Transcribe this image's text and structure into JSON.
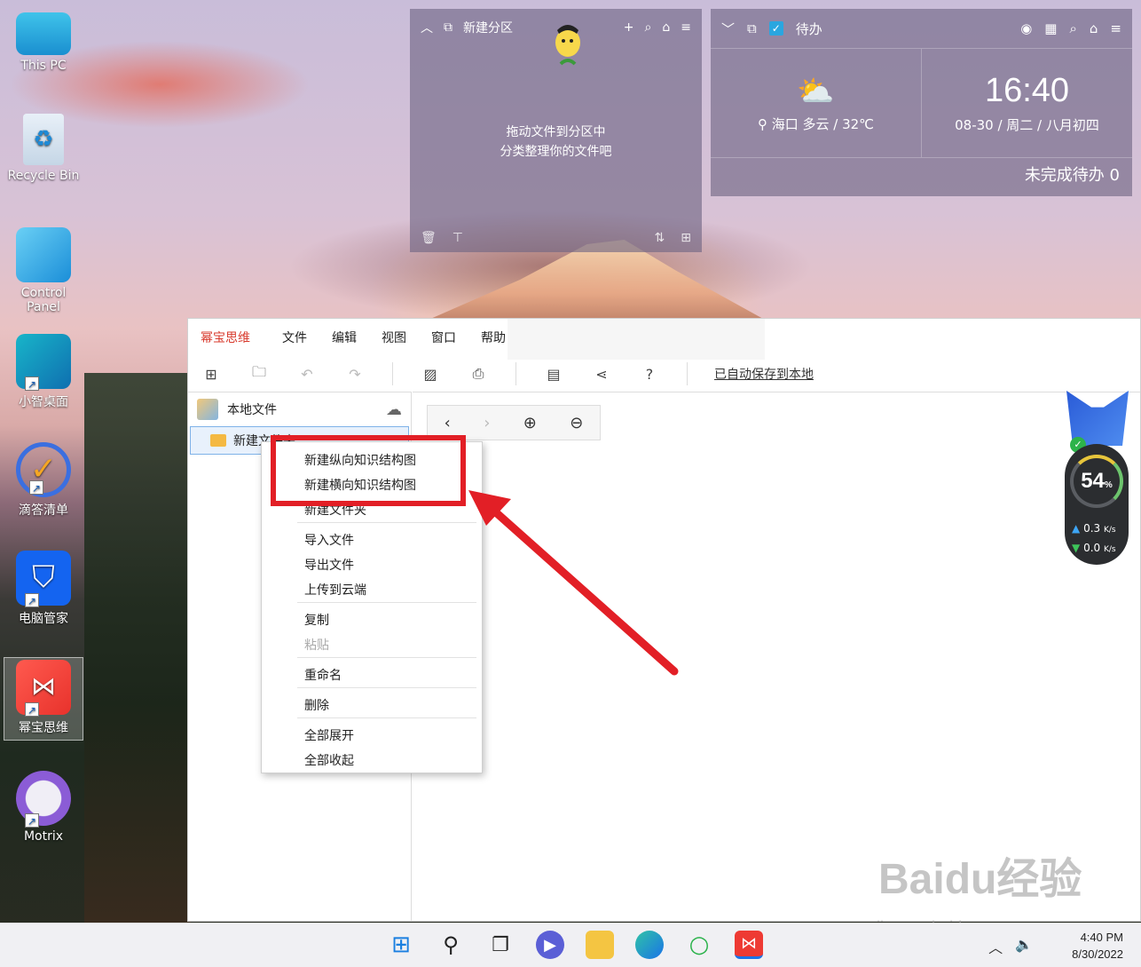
{
  "desktop": {
    "icons": [
      {
        "label": "This PC",
        "icon": "monitor-icon"
      },
      {
        "label": "Recycle Bin",
        "icon": "recycle-bin-icon"
      },
      {
        "label": "Control Panel",
        "icon": "control-panel-icon"
      },
      {
        "label": "小智桌面",
        "icon": "desktop-app-icon"
      },
      {
        "label": "滴答清单",
        "icon": "checklist-icon"
      },
      {
        "label": "电脑管家",
        "icon": "shield-icon"
      },
      {
        "label": "幂宝思维",
        "icon": "mindmap-icon"
      },
      {
        "label": "Motrix",
        "icon": "download-icon"
      }
    ]
  },
  "partition_widget": {
    "title": "新建分区",
    "message_line1": "拖动文件到分区中",
    "message_line2": "分类整理你的文件吧"
  },
  "todo_widget": {
    "title": "待办",
    "time": "16:40",
    "date": "08-30 / 周二 / 八月初四",
    "weather": "海口 多云 / 32℃",
    "pending": "未完成待办 0"
  },
  "app": {
    "brand": "幂宝思维",
    "menu": [
      "文件",
      "编辑",
      "视图",
      "窗口",
      "帮助"
    ],
    "autosave": "已自动保存到本地",
    "sidebar": {
      "header": "本地文件",
      "folder": "新建文件夹"
    }
  },
  "context_menu": {
    "items": [
      {
        "label": "新建纵向知识结构图",
        "enabled": true
      },
      {
        "label": "新建横向知识结构图",
        "enabled": true
      },
      {
        "label": "新建文件夹",
        "enabled": true
      },
      {
        "label": "导入文件",
        "enabled": true
      },
      {
        "label": "导出文件",
        "enabled": true
      },
      {
        "label": "上传到云端",
        "enabled": true
      },
      {
        "label": "复制",
        "enabled": true
      },
      {
        "label": "粘贴",
        "enabled": false
      },
      {
        "label": "重命名",
        "enabled": true
      },
      {
        "label": "删除",
        "enabled": true
      },
      {
        "label": "全部展开",
        "enabled": true
      },
      {
        "label": "全部收起",
        "enabled": true
      }
    ],
    "highlight_color": "#e21f26"
  },
  "monitor": {
    "percent": "54",
    "percent_unit": "%",
    "upload": "0.3",
    "download": "0.0",
    "rate_unit": "K/s"
  },
  "taskbar": {
    "time": "4:40 PM",
    "date": "8/30/2022"
  },
  "watermark": {
    "brand": "Baidu经验",
    "url": "jingyan.baidu.com"
  }
}
